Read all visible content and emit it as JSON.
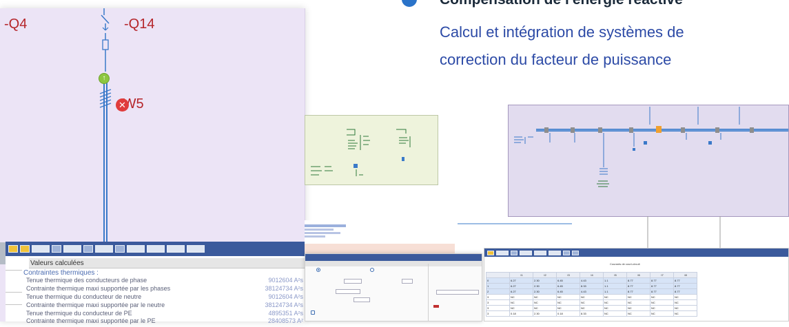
{
  "heading": {
    "title": "Compensation de l'énergie réactive",
    "line1": "Calcul et intégration de systèmes de",
    "line2": "correction du facteur de puissance"
  },
  "diagram": {
    "label_q4": "-Q4",
    "label_q14": "-Q14",
    "label_w5": "-W5",
    "colors": {
      "background": "#ece4f6",
      "labels": "#b5252a",
      "node": "#8dc63f",
      "error": "#e03c3c"
    }
  },
  "calc_panel": {
    "title": "Valeurs calculées",
    "section": "Contraintes thermiques :",
    "rows": [
      {
        "label": "Tenue thermique des conducteurs de phase",
        "value": "9012604 A²s"
      },
      {
        "label": "Contrainte thermique maxi supportée par les phases",
        "value": "38124734 A²s"
      },
      {
        "label": "Tenue thermique du conducteur de neutre",
        "value": "9012604 A²s"
      },
      {
        "label": "Contrainte thermique maxi supportée par le neutre",
        "value": "38124734 A²s"
      },
      {
        "label": "Tenue thermique du conducteur de PE",
        "value": "4895351 A²s"
      },
      {
        "label": "Contrainte thermique maxi supportée par le PE",
        "value": "28408573 A²"
      }
    ]
  },
  "table_window": {
    "caption": "Courants de court-circuit",
    "headers": [
      "",
      "I1",
      "I2",
      "I3",
      "I4",
      "I5",
      "I6",
      "I7",
      "I8"
    ],
    "rows": [
      [
        "0",
        "6.27",
        "2.30",
        "6.45",
        "4.43",
        "1.1",
        "8.77",
        "8.77",
        "8.77"
      ],
      [
        "1",
        "6.27",
        "2.30",
        "6.45",
        "8.33",
        "1.1",
        "8.77",
        "8.77",
        "8.77"
      ],
      [
        "2",
        "6.27",
        "2.30",
        "6.45",
        "4.43",
        "1.1",
        "8.77",
        "8.77",
        "8.77"
      ],
      [
        "3",
        "NC",
        "NC",
        "NC",
        "NC",
        "NC",
        "NC",
        "NC",
        "NC"
      ],
      [
        "3",
        "NC",
        "NC",
        "NC",
        "NC",
        "NC",
        "NC",
        "NC",
        "NC"
      ],
      [
        "3",
        "NC",
        "NC",
        "NC",
        "NC",
        "NC",
        "NC",
        "NC",
        "NC"
      ],
      [
        "3",
        "0.18",
        "2.30",
        "0.18",
        "8.33",
        "NC",
        "NC",
        "NC",
        "NC"
      ]
    ]
  }
}
